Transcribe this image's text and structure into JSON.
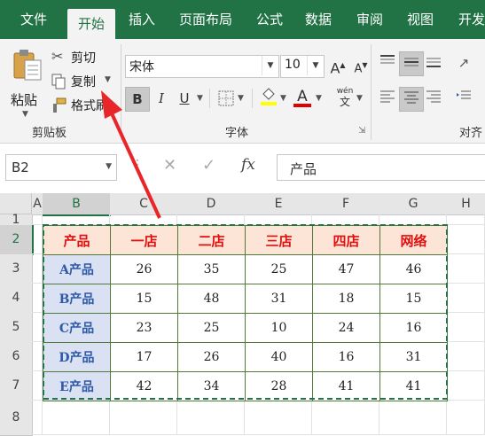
{
  "ribbon_tabs": [
    "文件",
    "开始",
    "插入",
    "页面布局",
    "公式",
    "数据",
    "审阅",
    "视图",
    "开发"
  ],
  "clipboard": {
    "paste_label": "粘贴",
    "cut_label": "剪切",
    "copy_label": "复制",
    "format_painter_label": "格式刷",
    "group_label": "剪贴板"
  },
  "font": {
    "name": "宋体",
    "size": "10",
    "bold": "B",
    "italic": "I",
    "underline": "U",
    "grow": "A",
    "shrink": "A",
    "font_color_glyph": "A",
    "phonetic_top": "wén",
    "phonetic_bottom": "文",
    "group_label": "字体"
  },
  "alignment": {
    "group_label": "对齐"
  },
  "formula_bar": {
    "name_box": "B2",
    "fx": "fx",
    "content": "产品"
  },
  "sheet": {
    "columns": [
      "A",
      "B",
      "C",
      "D",
      "E",
      "F",
      "G",
      "H"
    ],
    "rows": [
      "1",
      "2",
      "3",
      "4",
      "5",
      "6",
      "7",
      "8"
    ],
    "active_column": "B",
    "active_row": "2",
    "table_header": [
      "产品",
      "一店",
      "二店",
      "三店",
      "四店",
      "网络"
    ],
    "table_rows": [
      [
        "A产品",
        "26",
        "35",
        "25",
        "47",
        "46"
      ],
      [
        "B产品",
        "15",
        "48",
        "31",
        "18",
        "15"
      ],
      [
        "C产品",
        "23",
        "25",
        "10",
        "24",
        "16"
      ],
      [
        "D产品",
        "17",
        "26",
        "40",
        "16",
        "31"
      ],
      [
        "E产品",
        "42",
        "34",
        "28",
        "41",
        "41"
      ]
    ]
  },
  "colors": {
    "ribbon_green": "#217346",
    "header_fill": "#fce4d6",
    "header_text": "#e01010",
    "rowlabel_fill": "#d9e1f2",
    "rowlabel_text": "#2f5aa8",
    "marching_ants": "#217346",
    "annotation_arrow": "#e8262a"
  }
}
